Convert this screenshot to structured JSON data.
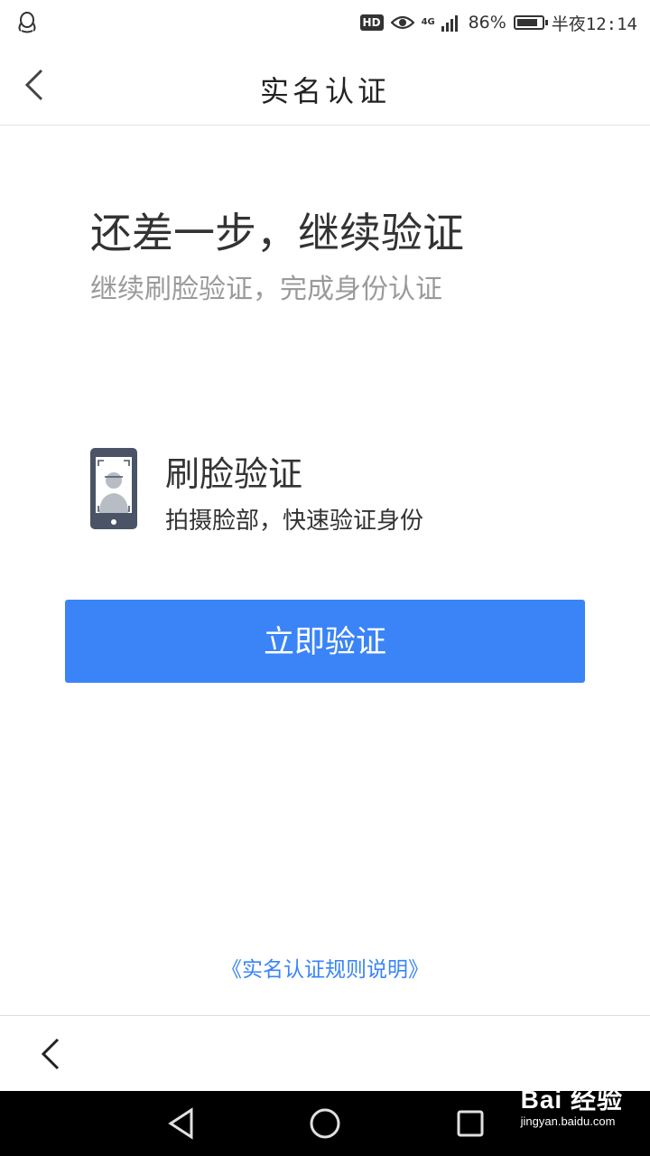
{
  "status_bar": {
    "hd": "HD",
    "network": "4G",
    "battery_percent": "86%",
    "battery_level": 0.86,
    "time": "半夜12:14"
  },
  "header": {
    "title": "实名认证"
  },
  "main": {
    "headline": "还差一步，继续验证",
    "subtitle": "继续刷脸验证，完成身份认证",
    "method": {
      "title": "刷脸验证",
      "description": "拍摄脸部，快速验证身份"
    },
    "verify_button": "立即验证",
    "rules_link": "《实名认证规则说明》"
  },
  "watermark": {
    "brand": "Bai 经验",
    "url": "jingyan.baidu.com"
  },
  "colors": {
    "accent": "#3a84f7",
    "text_primary": "#333333",
    "text_secondary": "#9a9a9a",
    "phone_icon": "#4a5466"
  }
}
